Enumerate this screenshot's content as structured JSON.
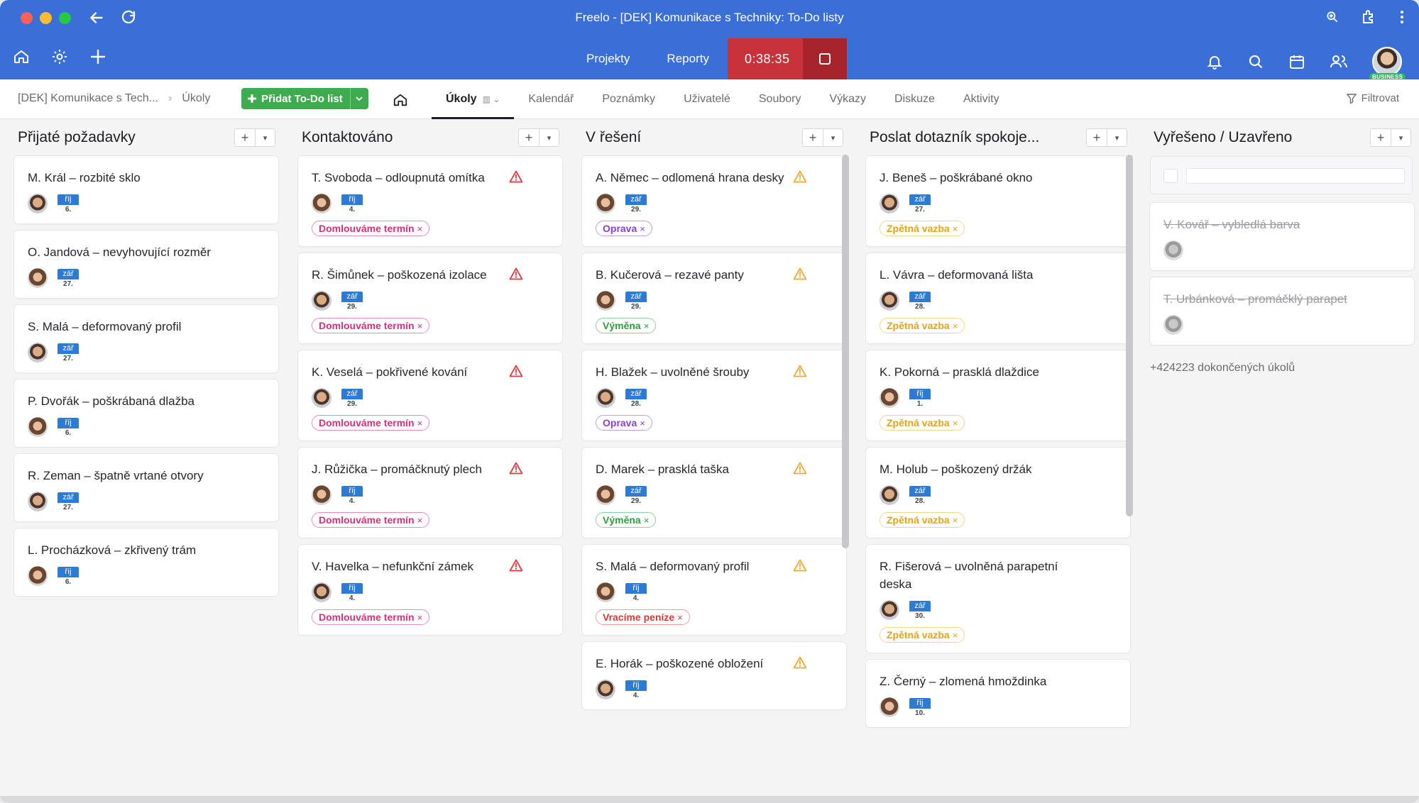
{
  "window": {
    "title": "Freelo - [DEK] Komunikace s Techniky: To-Do listy"
  },
  "nav": {
    "projects": "Projekty",
    "reports": "Reporty",
    "timer": "0:38:35",
    "badge": "BUSINESS"
  },
  "toolbar": {
    "crumb_project": "[DEK] Komunikace s Tech...",
    "crumb_section": "Úkoly",
    "add_list": "Přidat To-Do list",
    "tabs": [
      "Úkoly",
      "Kalendář",
      "Poznámky",
      "Uživatelé",
      "Soubory",
      "Výkazy",
      "Diskuze",
      "Aktivity"
    ],
    "filter": "Filtrovat"
  },
  "columns": [
    {
      "title": "Přijaté požadavky",
      "cards": [
        {
          "title": "M. Král – rozbité sklo",
          "month": "říj",
          "day": "6.",
          "avatar": "m"
        },
        {
          "title": "O. Jandová – nevyhovující rozměr",
          "month": "zář",
          "day": "27.",
          "avatar": "f"
        },
        {
          "title": "S. Malá – deformovaný profil",
          "month": "zář",
          "day": "27.",
          "avatar": "m"
        },
        {
          "title": "P. Dvořák – poškrábaná dlažba",
          "month": "říj",
          "day": "6.",
          "avatar": "f"
        },
        {
          "title": "R. Zeman – špatně vrtané otvory",
          "month": "zář",
          "day": "27.",
          "avatar": "m"
        },
        {
          "title": "L. Procházková – zkřivený trám",
          "month": "říj",
          "day": "6.",
          "avatar": "f"
        }
      ]
    },
    {
      "title": "Kontaktováno",
      "cards": [
        {
          "title": "T. Svoboda – odloupnutá omítka",
          "month": "říj",
          "day": "4.",
          "avatar": "f",
          "tag": "Domlouváme termín",
          "tagColor": "pink",
          "warn": "red"
        },
        {
          "title": "R. Šimůnek – poškozená izolace",
          "month": "zář",
          "day": "29.",
          "avatar": "m",
          "tag": "Domlouváme termín",
          "tagColor": "pink",
          "warn": "red"
        },
        {
          "title": "K. Veselá – pokřivené kování",
          "month": "zář",
          "day": "29.",
          "avatar": "m",
          "tag": "Domlouváme termín",
          "tagColor": "pink",
          "warn": "red"
        },
        {
          "title": "J. Růžička – promáčknutý plech",
          "month": "říj",
          "day": "4.",
          "avatar": "f",
          "tag": "Domlouváme termín",
          "tagColor": "pink",
          "warn": "red"
        },
        {
          "title": "V. Havelka – nefunkční zámek",
          "month": "říj",
          "day": "4.",
          "avatar": "m",
          "tag": "Domlouváme termín",
          "tagColor": "pink",
          "warn": "red"
        }
      ]
    },
    {
      "title": "V řešení",
      "cards": [
        {
          "title": "A. Němec – odlomená hrana desky",
          "month": "zář",
          "day": "29.",
          "avatar": "f",
          "tag": "Oprava",
          "tagColor": "purple",
          "warn": "orange"
        },
        {
          "title": "B. Kučerová – rezavé panty",
          "month": "zář",
          "day": "29.",
          "avatar": "f",
          "tag": "Výměna",
          "tagColor": "green",
          "warn": "orange"
        },
        {
          "title": "H. Blažek – uvolněné šrouby",
          "month": "zář",
          "day": "28.",
          "avatar": "m",
          "tag": "Oprava",
          "tagColor": "purple",
          "warn": "orange"
        },
        {
          "title": "D. Marek – prasklá taška",
          "month": "zář",
          "day": "29.",
          "avatar": "f",
          "tag": "Výměna",
          "tagColor": "green",
          "warn": "orange"
        },
        {
          "title": "S. Malá – deformovaný profil",
          "month": "říj",
          "day": "4.",
          "avatar": "f",
          "tag": "Vracíme peníze",
          "tagColor": "red",
          "warn": "orange"
        },
        {
          "title": "E. Horák – poškozené obložení",
          "month": "říj",
          "day": "4.",
          "avatar": "m",
          "warn": "orange"
        }
      ]
    },
    {
      "title": "Poslat dotazník spokoje...",
      "cards": [
        {
          "title": "J. Beneš – poškrábané okno",
          "month": "zář",
          "day": "27.",
          "avatar": "m",
          "tag": "Zpětná vazba",
          "tagColor": "yellow"
        },
        {
          "title": "L. Vávra – deformovaná lišta",
          "month": "zář",
          "day": "28.",
          "avatar": "m",
          "tag": "Zpětná vazba",
          "tagColor": "yellow"
        },
        {
          "title": "K. Pokorná – prasklá dlaždice",
          "month": "říj",
          "day": "1.",
          "avatar": "f",
          "tag": "Zpětná vazba",
          "tagColor": "yellow"
        },
        {
          "title": "M. Holub – poškozený držák",
          "month": "zář",
          "day": "28.",
          "avatar": "m",
          "tag": "Zpětná vazba",
          "tagColor": "yellow"
        },
        {
          "title": "R. Fišerová – uvolněná parapetní deska",
          "month": "zář",
          "day": "30.",
          "avatar": "m",
          "tag": "Zpětná vazba",
          "tagColor": "yellow"
        },
        {
          "title": "Z. Černý – zlomená hmoždinka",
          "month": "říj",
          "day": "10.",
          "avatar": "f"
        }
      ]
    },
    {
      "title": "Vyřešeno / Uzavřeno",
      "done": true,
      "cards": [
        {
          "title": "V. Kovář – vybledlá barva",
          "avatar": "g"
        },
        {
          "title": "T. Urbánková – promáčklý parapet",
          "avatar": "g"
        }
      ],
      "done_note": "+424223 dokončených úkolů"
    }
  ],
  "colors": {
    "brand": "#3b6fd8",
    "timer": "#c8323a",
    "add_button": "#3eab4f",
    "date_badge": "#2d7bd4"
  }
}
